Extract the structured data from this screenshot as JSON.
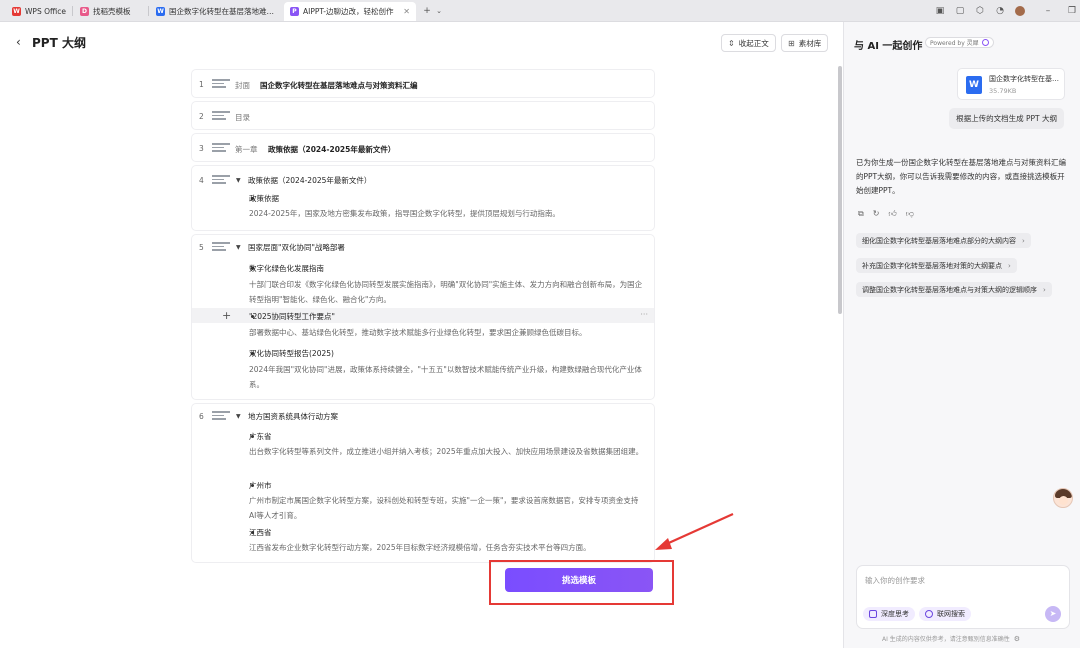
{
  "tabs": [
    {
      "label": "WPS Office",
      "icon": "wps-icon",
      "color": "#e53935"
    },
    {
      "label": "找稻壳模板",
      "icon": "docer-icon",
      "color": "#e53935"
    },
    {
      "label": "国企数字化转型在基层落地难点与对",
      "icon": "word-doc-icon",
      "color": "#2b6cf0"
    },
    {
      "label": "AIPPT-边聊边改，轻松创作",
      "icon": "aippt-icon",
      "color": "#8a55f5"
    }
  ],
  "header": {
    "back": "‹",
    "title": "PPT 大纲",
    "collapse_btn": "收起正文",
    "material_btn": "素材库"
  },
  "outline": {
    "row1": {
      "num": "1",
      "tag": "封面",
      "title": "国企数字化转型在基层落地难点与对策资料汇编"
    },
    "row2": {
      "num": "2",
      "tag": "目录"
    },
    "row3": {
      "num": "3",
      "tag": "第一章",
      "title": "政策依据（2024-2025年最新文件）"
    },
    "row4": {
      "num": "4",
      "heading": "政策依据（2024-2025年最新文件）",
      "items": [
        {
          "title": "政策依据",
          "text": "2024-2025年，国家及地方密集发布政策，指导国企数字化转型，提供顶层规划与行动指南。"
        }
      ]
    },
    "row5": {
      "num": "5",
      "heading": "国家层面\"双化协同\"战略部署",
      "items": [
        {
          "title": "数字化绿色化发展指南",
          "text": "十部门联合印发《数字化绿色化协同转型发展实施指南》，明确\"双化协同\"实施主体、发力方向和融合创新布局，为国企转型指明\"智能化、绿色化、融合化\"方向。"
        },
        {
          "title": "\"2025协同转型工作要点\"",
          "text": "部署数据中心、基站绿色化转型，推动数字技术赋能多行业绿色化转型，要求国企兼顾绿色低碳目标。"
        },
        {
          "title": "双化协同转型报告(2025)",
          "text": "2024年我国\"双化协同\"进展，政策体系持续健全，\"十五五\"以数智技术赋能传统产业升级，构建数绿融合现代化产业体系。"
        }
      ]
    },
    "row6": {
      "num": "6",
      "heading": "地方国资系统具体行动方案",
      "items": [
        {
          "title": "广东省",
          "text": "出台数字化转型等系列文件，成立推进小组并纳入考核；2025年重点加大投入、加快应用场景建设及省数据集团组建。"
        },
        {
          "title": "广州市",
          "text": "广州市制定市属国企数字化转型方案，设科创处和转型专班，实施\"一企一策\"，要求设首席数据官，安排专项资金支持AI等人才引育。"
        },
        {
          "title": "江西省",
          "text": "江西省发布企业数字化转型行动方案，2025年目标数字经济规模倍增，任务含夯实技术平台等四方面。"
        }
      ]
    },
    "hover_plus": "+",
    "hover_more": "···"
  },
  "cta": {
    "label": "挑选模板"
  },
  "side": {
    "title": "与 AI 一起创作",
    "powered": "Powered by 灵犀",
    "file": {
      "name": "国企数字化转型在基层落地难点与对策资料汇编",
      "size": "35.79KB"
    },
    "user_msg": "根据上传的文档生成 PPT 大纲",
    "ai_msg": "已为你生成一份国企数字化转型在基层落地难点与对策资料汇编的PPT大纲，你可以告诉我需要修改的内容，或直接挑选模板开始创建PPT。",
    "suggestions": [
      "细化国企数字化转型基层落地难点部分的大纲内容",
      "补充国企数字化转型基层落地对策的大纲要点",
      "调整国企数字化转型基层落地难点与对策大纲的逻辑顺序"
    ],
    "input_placeholder": "输入你的创作要求",
    "chip_deep": "深度思考",
    "chip_web": "联网搜索",
    "disclaimer": "AI 生成的内容仅供参考，请注意甄别信息准确性"
  }
}
